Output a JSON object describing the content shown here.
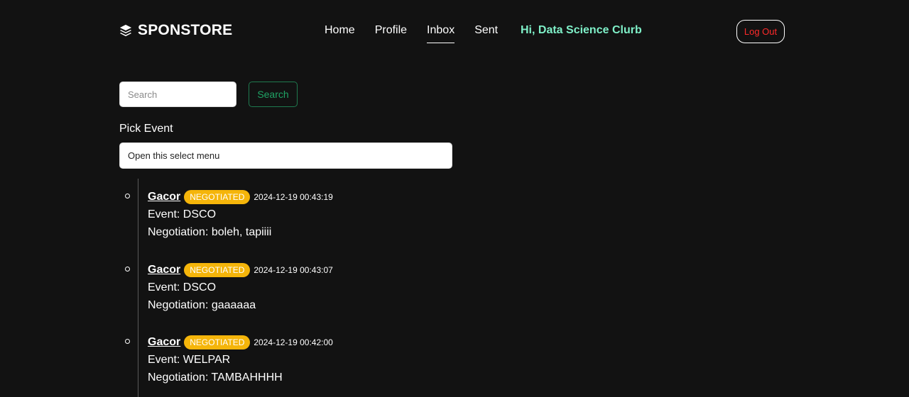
{
  "brand": {
    "name": "SPONSTORE",
    "icon": "layers-icon"
  },
  "nav": {
    "items": [
      {
        "label": "Home",
        "active": false
      },
      {
        "label": "Profile",
        "active": false
      },
      {
        "label": "Inbox",
        "active": true
      },
      {
        "label": "Sent",
        "active": false
      }
    ],
    "greeting": "Hi, Data Science Clurb",
    "logout_label": "Log Out"
  },
  "search": {
    "placeholder": "Search",
    "value": "",
    "button_label": "Search"
  },
  "pick_event": {
    "label": "Pick Event",
    "selected": "Open this select menu"
  },
  "messages": [
    {
      "sender": "Gacor",
      "status": "NEGOTIATED",
      "timestamp": "2024-12-19 00:43:19",
      "event": "Event: DSCO",
      "negotiation": "Negotiation: boleh, tapiiii"
    },
    {
      "sender": "Gacor",
      "status": "NEGOTIATED",
      "timestamp": "2024-12-19 00:43:07",
      "event": "Event: DSCO",
      "negotiation": "Negotiation: gaaaaaa"
    },
    {
      "sender": "Gacor",
      "status": "NEGOTIATED",
      "timestamp": "2024-12-19 00:42:00",
      "event": "Event: WELPAR",
      "negotiation": "Negotiation: TAMBAHHHH"
    }
  ],
  "colors": {
    "background": "#121212",
    "greeting": "#7ff0c8",
    "logout_text": "#ff2a2a",
    "search_button": "#1fa365",
    "badge": "#f5b50a"
  }
}
